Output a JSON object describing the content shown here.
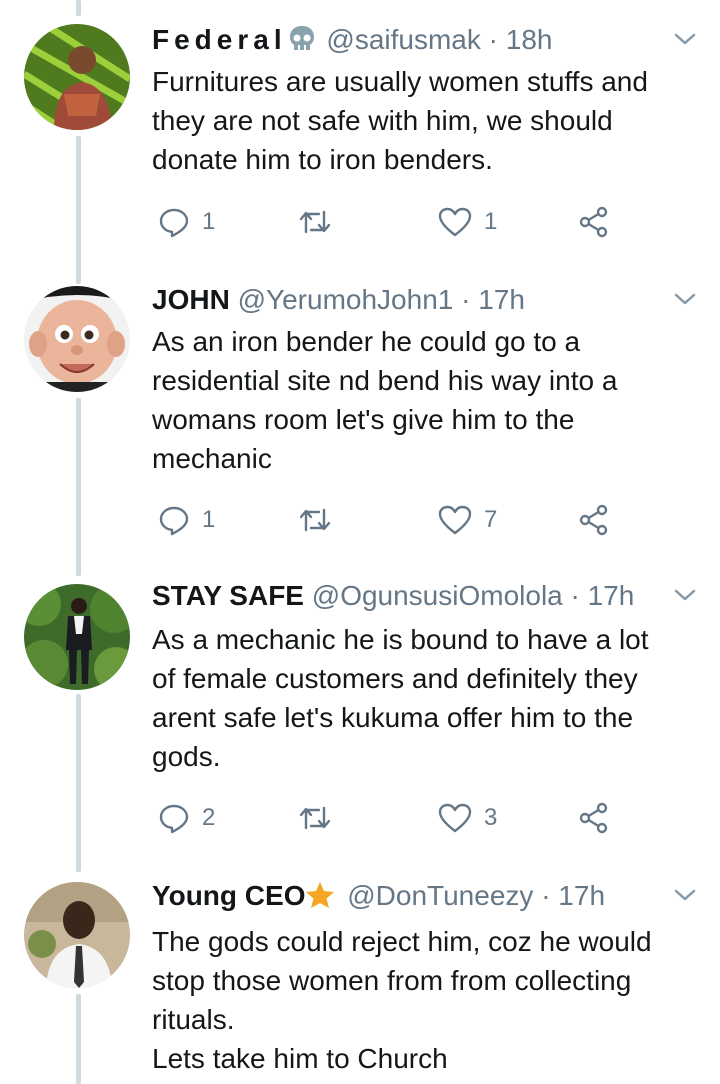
{
  "tweets": [
    {
      "name": "Federal",
      "handle": "@saifusmak",
      "dot": "·",
      "time": "18h",
      "badge": "skull-icon",
      "text": "Furnitures are usually women stuffs and\nthey are not safe with him, we should\ndonate him to iron benders.",
      "replies": "1",
      "retweets": "",
      "likes": "1"
    },
    {
      "name": "JOHN",
      "handle": "@YerumohJohn1",
      "dot": "·",
      "time": "17h",
      "badge": "",
      "text": "As an iron bender he could go to a\nresidential site nd bend his way into a\nwomans room let's give him to the\nmechanic",
      "replies": "1",
      "retweets": "",
      "likes": "7"
    },
    {
      "name": "STAY SAFE",
      "handle": "@OgunsusiOmolola",
      "dot": "·",
      "time": "17h",
      "badge": "",
      "text": "As a mechanic he is bound to have a lot\nof female customers and definitely they\narent safe let's kukuma offer him to the\ngods.",
      "replies": "2",
      "retweets": "",
      "likes": "3"
    },
    {
      "name": "Young CEO",
      "handle": "@DonTuneezy",
      "dot": "·",
      "time": "17h",
      "badge": "star-icon",
      "text": "The gods could reject him, coz he would\nstop those women from from collecting\nrituals.\nLets take him to Church",
      "replies": "",
      "retweets": "",
      "likes": ""
    }
  ],
  "colors": {
    "text": "#14171a",
    "muted": "#657786",
    "thread_line": "#cfd9de",
    "star": "#f5a623"
  }
}
